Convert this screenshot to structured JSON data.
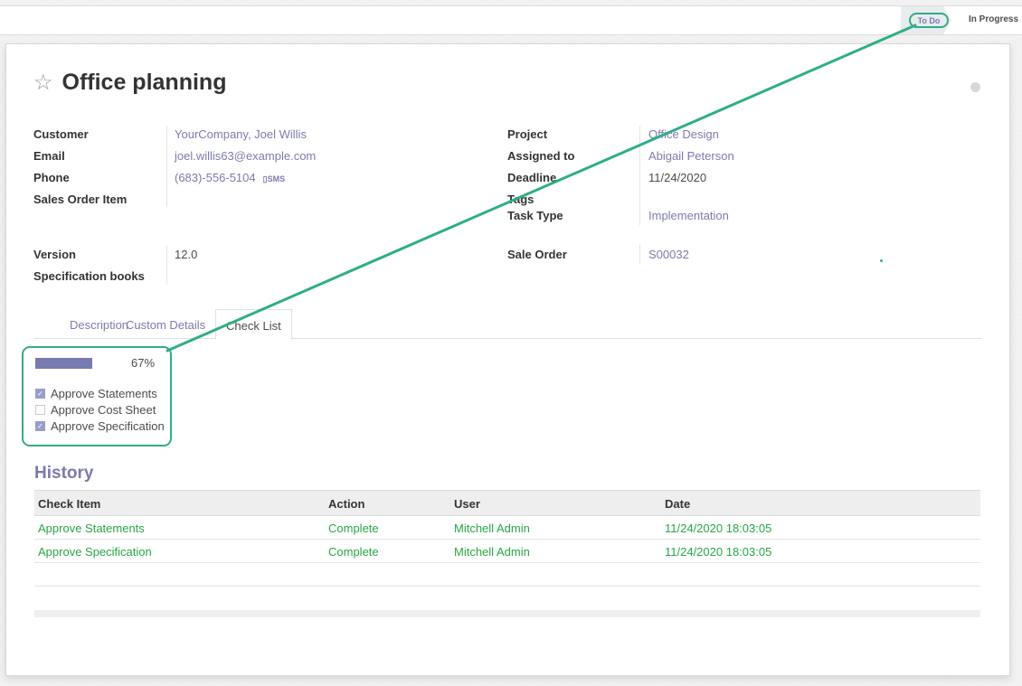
{
  "stages": {
    "todo": "To Do",
    "in_progress": "In Progress"
  },
  "record": {
    "title": "Office planning",
    "star_icon": "star-outline-icon",
    "left_fields": [
      {
        "label": "Customer",
        "value": "YourCompany, Joel Willis"
      },
      {
        "label": "Email",
        "value": "joel.willis63@example.com"
      },
      {
        "label": "Phone",
        "value": "(683)-556-5104",
        "sms": "SMS"
      },
      {
        "label": "Sales Order Item",
        "value": ""
      }
    ],
    "right_fields": [
      {
        "label": "Project",
        "value": "Office Design"
      },
      {
        "label": "Assigned to",
        "value": "Abigail Peterson"
      },
      {
        "label": "Deadline",
        "value": "11/24/2020"
      },
      {
        "label": "Tags",
        "value": ""
      },
      {
        "label": "Task Type",
        "value": "Implementation"
      }
    ],
    "version": {
      "label": "Version",
      "value": "12.0"
    },
    "spec_books": {
      "label": "Specification books",
      "value": ""
    },
    "sale_order": {
      "label": "Sale Order",
      "value": "S00032"
    }
  },
  "tabs": [
    "Description",
    "Custom Details",
    "Check List"
  ],
  "active_tab": "Check List",
  "checklist": {
    "progress_label": "67%",
    "progress": 0.67,
    "items": [
      {
        "label": "Approve Statements",
        "checked": true
      },
      {
        "label": "Approve Cost Sheet",
        "checked": false
      },
      {
        "label": "Approve Specification",
        "checked": true
      }
    ]
  },
  "history": {
    "title": "History",
    "columns": [
      "Check Item",
      "Action",
      "User",
      "Date"
    ],
    "rows": [
      [
        "Approve Statements",
        "Complete",
        "Mitchell Admin",
        "11/24/2020 18:03:05"
      ],
      [
        "Approve Specification",
        "Complete",
        "Mitchell Admin",
        "11/24/2020 18:03:05"
      ]
    ]
  },
  "colors": {
    "accent": "#7c7bad",
    "highlight": "#2fae87",
    "history_text": "#28a745"
  }
}
